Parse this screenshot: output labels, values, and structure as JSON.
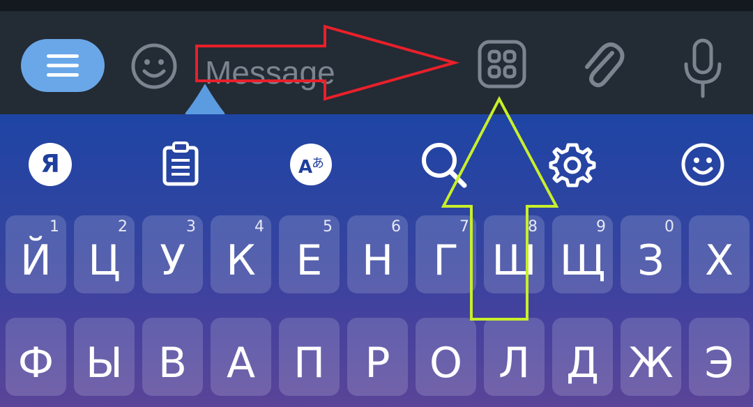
{
  "input_bar": {
    "menu_icon": "hamburger-icon",
    "emoji_icon": "smiley-icon",
    "message_placeholder": "Message",
    "message_value": "",
    "apps_icon": "grid-apps-icon",
    "attach_icon": "paperclip-icon",
    "mic_icon": "microphone-icon"
  },
  "keyboard": {
    "toolbar": [
      {
        "name": "yandex-logo-icon",
        "label": "Я"
      },
      {
        "name": "clipboard-icon"
      },
      {
        "name": "translate-icon"
      },
      {
        "name": "search-icon"
      },
      {
        "name": "settings-gear-icon"
      },
      {
        "name": "emoji-icon"
      }
    ],
    "row1": [
      {
        "char": "Й",
        "hint": "1"
      },
      {
        "char": "Ц",
        "hint": "2"
      },
      {
        "char": "У",
        "hint": "3"
      },
      {
        "char": "К",
        "hint": "4"
      },
      {
        "char": "Е",
        "hint": "5"
      },
      {
        "char": "Н",
        "hint": "6"
      },
      {
        "char": "Г",
        "hint": "7"
      },
      {
        "char": "Ш",
        "hint": "8"
      },
      {
        "char": "Щ",
        "hint": "9"
      },
      {
        "char": "З",
        "hint": "0"
      },
      {
        "char": "Х",
        "hint": ""
      }
    ],
    "row2": [
      {
        "char": "Ф"
      },
      {
        "char": "Ы"
      },
      {
        "char": "В"
      },
      {
        "char": "А"
      },
      {
        "char": "П"
      },
      {
        "char": "Р"
      },
      {
        "char": "О"
      },
      {
        "char": "Л"
      },
      {
        "char": "Д"
      },
      {
        "char": "Ж"
      },
      {
        "char": "Э"
      }
    ]
  },
  "annotations": {
    "red_arrow_color": "#e8202a",
    "green_arrow_color": "#c8ef2a"
  },
  "colors": {
    "menu_button": "#69a7e8",
    "input_bar_bg": "#232b35",
    "icon_gray": "#7b848f"
  }
}
